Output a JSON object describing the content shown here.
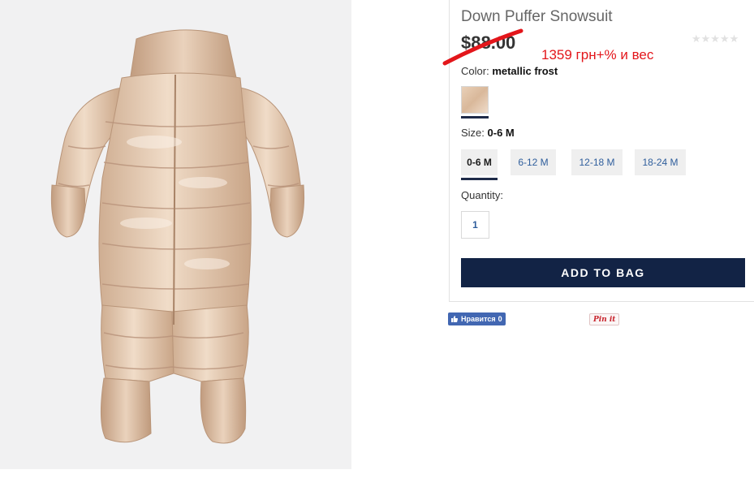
{
  "product": {
    "title": "Down Puffer Snowsuit",
    "price": "$88.00",
    "annotation": "1359 грн+% и вес",
    "rating_stars": "★★★★★",
    "color_label": "Color:",
    "color_value": "metallic frost",
    "size_label": "Size:",
    "size_value": "0-6 M",
    "sizes": [
      "0-6 M",
      "6-12 M",
      "12-18 M",
      "18-24 M"
    ],
    "selected_size": "0-6 M",
    "quantity_label": "Quantity:",
    "quantity_value": "1",
    "add_to_bag_label": "ADD TO BAG"
  },
  "social": {
    "like_label": "Нравится",
    "like_count": "0",
    "pin_label": "Pin it"
  },
  "colors": {
    "primary_button": "#122345",
    "annotation": "#e3161b",
    "link": "#2f5e9c"
  },
  "icons": {
    "like": "thumbs-up-icon",
    "strike": "red-strikethrough-icon"
  }
}
